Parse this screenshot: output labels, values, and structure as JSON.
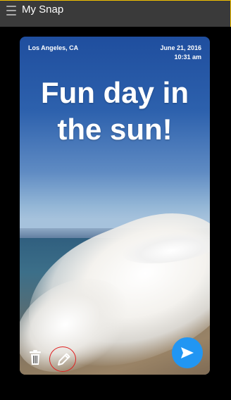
{
  "header": {
    "title": "My Snap",
    "menu_icon": "hamburger-menu-icon"
  },
  "snap": {
    "location": "Los Angeles, CA",
    "date": "June 21, 2016",
    "time": "10:31 am",
    "caption_line1": "Fun day in",
    "caption_line2": "the sun!"
  },
  "actions": {
    "delete_icon": "trash-icon",
    "edit_icon": "pencil-icon",
    "send_icon": "send-arrow-icon"
  },
  "colors": {
    "header_bg": "#3a3a3a",
    "accent_border": "#f0c000",
    "send_button": "#2196f3",
    "edit_highlight": "#e02020"
  }
}
